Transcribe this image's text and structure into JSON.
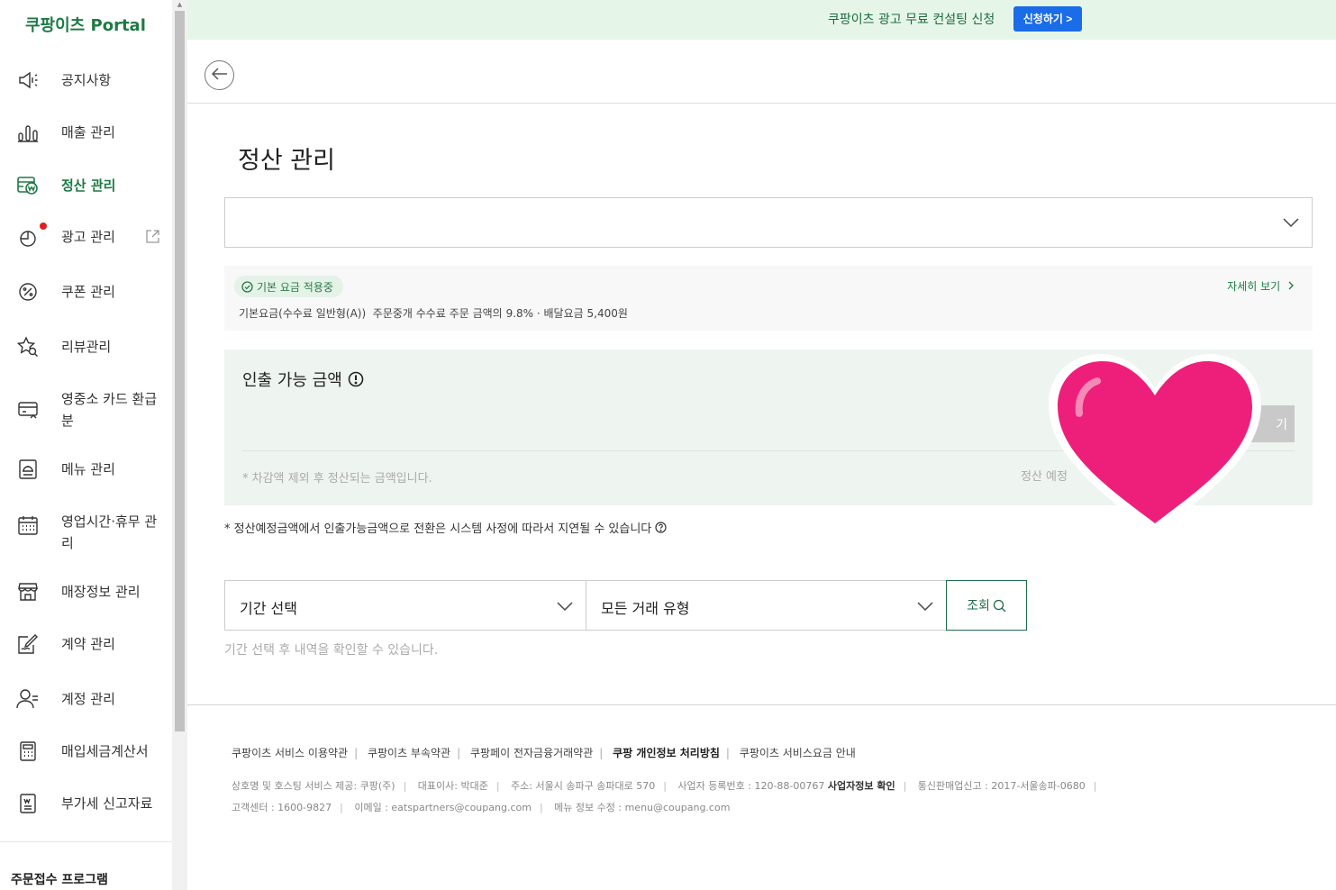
{
  "sidebar": {
    "logo": "쿠팡이츠 Portal",
    "items": [
      {
        "label": "공지사항",
        "icon": "megaphone-icon"
      },
      {
        "label": "매출 관리",
        "icon": "bar-chart-icon"
      },
      {
        "label": "정산 관리",
        "icon": "settlement-won-icon"
      },
      {
        "label": "광고 관리",
        "icon": "ad-pie-icon"
      },
      {
        "label": "쿠폰 관리",
        "icon": "coupon-percent-icon"
      },
      {
        "label": "리뷰관리",
        "icon": "review-star-icon"
      },
      {
        "label": "영중소 카드 환급분",
        "icon": "card-refund-icon"
      },
      {
        "label": "메뉴 관리",
        "icon": "menu-food-icon"
      },
      {
        "label": "영업시간·휴무 관리",
        "icon": "calendar-icon"
      },
      {
        "label": "매장정보 관리",
        "icon": "store-icon"
      },
      {
        "label": "계약 관리",
        "icon": "contract-icon"
      },
      {
        "label": "계정 관리",
        "icon": "account-user-icon"
      },
      {
        "label": "매입세금계산서",
        "icon": "calculator-icon"
      },
      {
        "label": "부가세 신고자료",
        "icon": "document-icon"
      }
    ],
    "order_program": "주문접수 프로그램"
  },
  "banner": {
    "text": "쿠팡이츠 광고 무료 컨설팅 신청",
    "button": "신청하기 >"
  },
  "page": {
    "title": "정산 관리"
  },
  "fee": {
    "badge": "기본 요금 적용중",
    "detail_link": "자세히 보기",
    "plan": "기본요금(수수료 일반형(A))",
    "desc": "주문중개 수수료 주문 금액의",
    "rate": "9.8%",
    "delivery": "· 배달요금",
    "delivery_fee": "5,400원"
  },
  "withdraw": {
    "title": "인출 가능 금액",
    "note": "* 차감액 제외 후 정산되는 금액입니다.",
    "pending": "정산 예정",
    "button": "기"
  },
  "system_note": "* 정산예정금액에서 인출가능금액으로 전환은 시스템 사정에 따라서 지연될 수 있습니다",
  "filters": {
    "period": "기간 선택",
    "type": "모든 거래 유형",
    "search": "조회",
    "hint": "기간 선택 후 내역을 확인할 수 있습니다."
  },
  "footer": {
    "links": [
      "쿠팡이츠 서비스 이용약관",
      "쿠팡이츠 부속약관",
      "쿠팡페이 전자금융거래약관",
      "쿠팡 개인정보 처리방침",
      "쿠팡이츠 서비스요금 안내"
    ],
    "info1": [
      "상호명 및 호스팅 서비스 제공: 쿠팡(주)",
      "대표이사: 박대준",
      "주소: 서울시 송파구 송파대로 570",
      "사업자 등록번호 : 120-88-00767",
      "사업자정보 확인",
      "통신판매업신고 : 2017-서울송파-0680"
    ],
    "info2": [
      "고객센터 : 1600-9827",
      "이메일 : eatspartners@coupang.com",
      "메뉴 정보 수정 : menu@coupang.com"
    ]
  },
  "colors": {
    "brand_green": "#1e7a45",
    "banner_bg": "#e5f6e9",
    "banner_button": "#1a6ce8",
    "heart": "#ee1f7a",
    "notification_dot": "#e02020"
  }
}
